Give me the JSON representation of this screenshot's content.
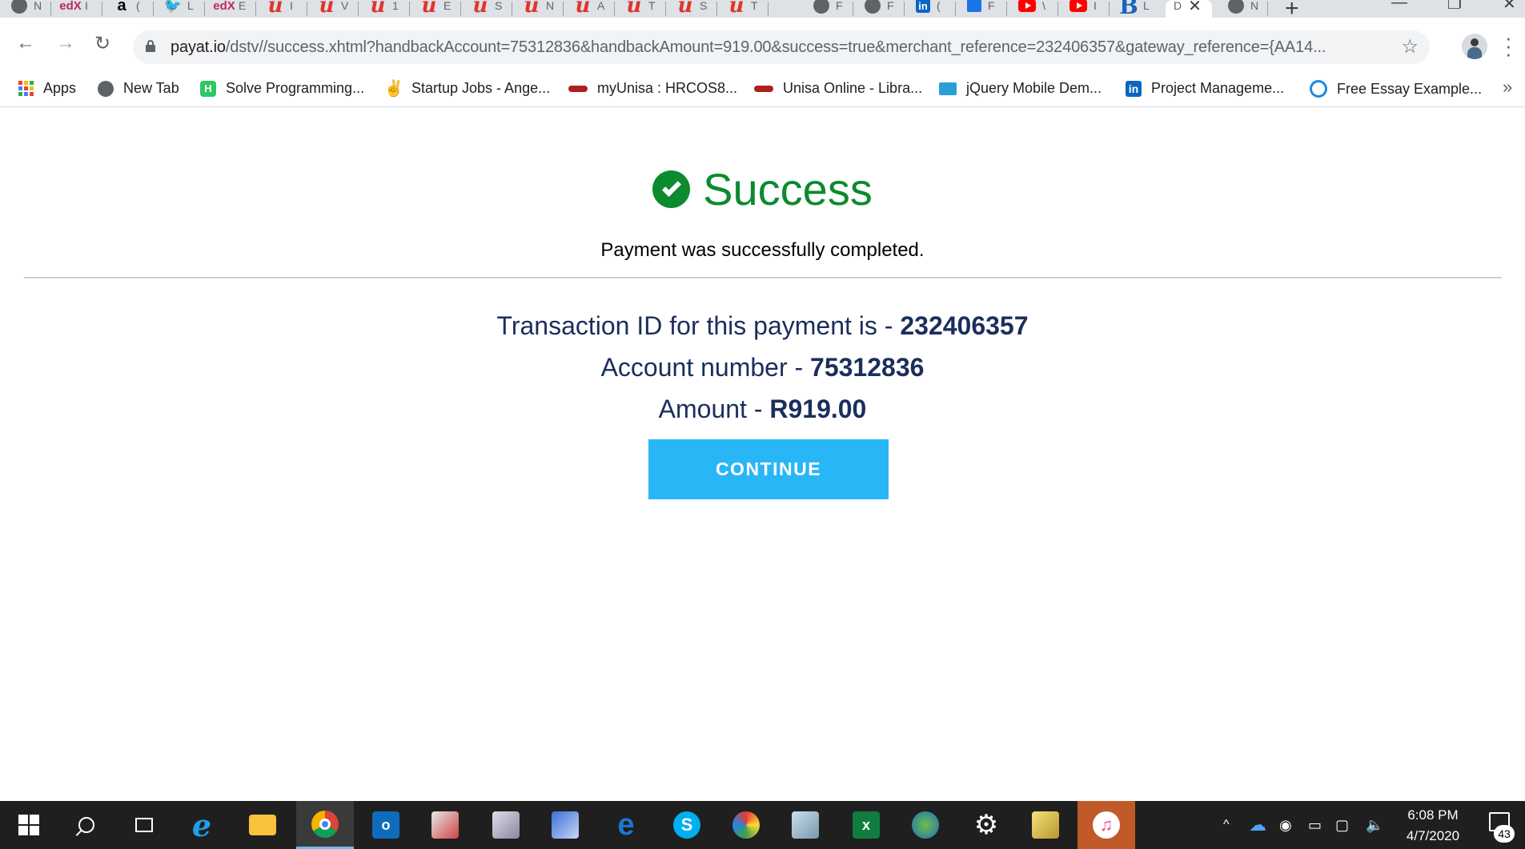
{
  "browser": {
    "tabs": [
      {
        "icon": "globe-icon",
        "title": "N"
      },
      {
        "icon": "edx-icon",
        "title": "I"
      },
      {
        "icon": "amazon-icon",
        "title": "("
      },
      {
        "icon": "twitter-icon",
        "title": "L"
      },
      {
        "icon": "edx-icon",
        "title": "E"
      },
      {
        "icon": "udemy-icon",
        "title": "I"
      },
      {
        "icon": "udemy-icon",
        "title": "V"
      },
      {
        "icon": "udemy-icon",
        "title": "1"
      },
      {
        "icon": "udemy-icon",
        "title": "E"
      },
      {
        "icon": "udemy-icon",
        "title": "S"
      },
      {
        "icon": "udemy-icon",
        "title": "N"
      },
      {
        "icon": "udemy-icon",
        "title": "A"
      },
      {
        "icon": "udemy-icon",
        "title": "T"
      },
      {
        "icon": "udemy-icon",
        "title": "S"
      },
      {
        "icon": "udemy-icon",
        "title": "T"
      },
      {
        "icon": "globe-icon",
        "title": "F"
      },
      {
        "icon": "globe-icon",
        "title": "F"
      },
      {
        "icon": "linkedin-icon",
        "title": "("
      },
      {
        "icon": "pluralsight-icon",
        "title": "F"
      },
      {
        "icon": "youtube-icon",
        "title": "\\"
      },
      {
        "icon": "youtube-icon",
        "title": "I"
      },
      {
        "icon": "bing-icon",
        "title": "L"
      },
      {
        "icon": "page-icon",
        "title": "D",
        "active": true
      },
      {
        "icon": "globe-icon",
        "title": "N"
      }
    ],
    "address": {
      "host": "payat.io",
      "path": "/dstv//success.xhtml?handbackAccount=75312836&handbackAmount=919.00&success=true&merchant_reference=232406357&gateway_reference={AA14..."
    },
    "bookmarks": [
      {
        "icon": "apps-icon",
        "label": "Apps"
      },
      {
        "icon": "globe-icon",
        "label": "New Tab"
      },
      {
        "icon": "hackerrank-icon",
        "label": "Solve Programming..."
      },
      {
        "icon": "angellist-icon",
        "label": "Startup Jobs - Ange..."
      },
      {
        "icon": "unisa-icon",
        "label": "myUnisa : HRCOS8..."
      },
      {
        "icon": "unisa-icon",
        "label": "Unisa Online - Libra..."
      },
      {
        "icon": "jquery-icon",
        "label": "jQuery Mobile Dem..."
      },
      {
        "icon": "linkedin-icon",
        "label": "Project Manageme..."
      },
      {
        "icon": "essay-icon",
        "label": "Free Essay Example..."
      }
    ],
    "bookmarks_more": "»"
  },
  "page": {
    "title": "Success",
    "subtitle": "Payment was successfully completed.",
    "transaction_label": "Transaction ID for this payment is - ",
    "transaction_id": "232406357",
    "account_label": "Account number - ",
    "account_number": "75312836",
    "amount_label": "Amount - ",
    "amount": "R919.00",
    "continue_label": "CONTINUE",
    "colors": {
      "success": "#0c8a2e",
      "text": "#1b2e5c",
      "button": "#29b6f6"
    }
  },
  "taskbar": {
    "apps": [
      "start-icon",
      "search-icon",
      "task-view-icon",
      "ie-icon",
      "file-explorer-icon",
      "chrome-icon",
      "outlook-icon",
      "snipping-icon",
      "network-icon",
      "remote-desktop-icon",
      "edge-icon",
      "skype-icon",
      "colorful-app-icon",
      "notes-icon",
      "excel-icon",
      "globe-app-icon",
      "settings-icon",
      "sticky-app-icon",
      "itunes-icon"
    ],
    "time": "6:08 PM",
    "date": "4/7/2020",
    "notifications": "43"
  }
}
